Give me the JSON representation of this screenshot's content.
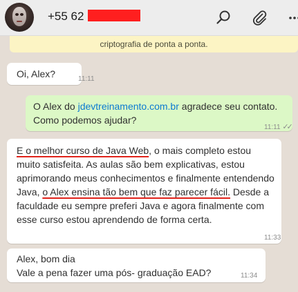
{
  "header": {
    "contact_name": "+55 62",
    "icons": [
      "search-icon",
      "attach-icon",
      "more-icon"
    ]
  },
  "banner": {
    "text": "criptografia de ponta a ponta."
  },
  "messages": [
    {
      "direction": "incoming",
      "text": "Oi, Alex?",
      "time": "11:11"
    },
    {
      "direction": "outgoing",
      "text_before": "O Alex do ",
      "link": "jdevtreinamento.com.br",
      "text_after": " agradece seu contato.",
      "line2": "Como podemos ajudar?",
      "time": "11:11"
    },
    {
      "direction": "incoming",
      "u1": "E o  melhor curso de Java Web",
      "t1": ", o mais completo estou muito satisfeita. As aulas são bem explicativas, estou aprimorando meus conhecimentos e finalmente entendendo Java, ",
      "u2": "o Alex ensina tão bem que faz parecer fácil.",
      "t2": " Desde a faculdade eu sempre preferi Java e agora finalmente com esse curso estou aprendendo de forma certa.",
      "time": "11:33"
    },
    {
      "direction": "incoming",
      "line1": "Alex, bom dia",
      "line2": "Vale a pena fazer uma pós- graduação EAD?",
      "time": "11:34"
    }
  ],
  "colors": {
    "header_bg": "#ededed",
    "chat_bg": "#e5ddd5",
    "outgoing_bubble": "#dcf8c6",
    "incoming_bubble": "#ffffff",
    "link": "#0b7ad1",
    "banner_bg": "#fcf4c4",
    "redaction": "#ff1f1f",
    "highlight_underline": "#e0221a"
  }
}
